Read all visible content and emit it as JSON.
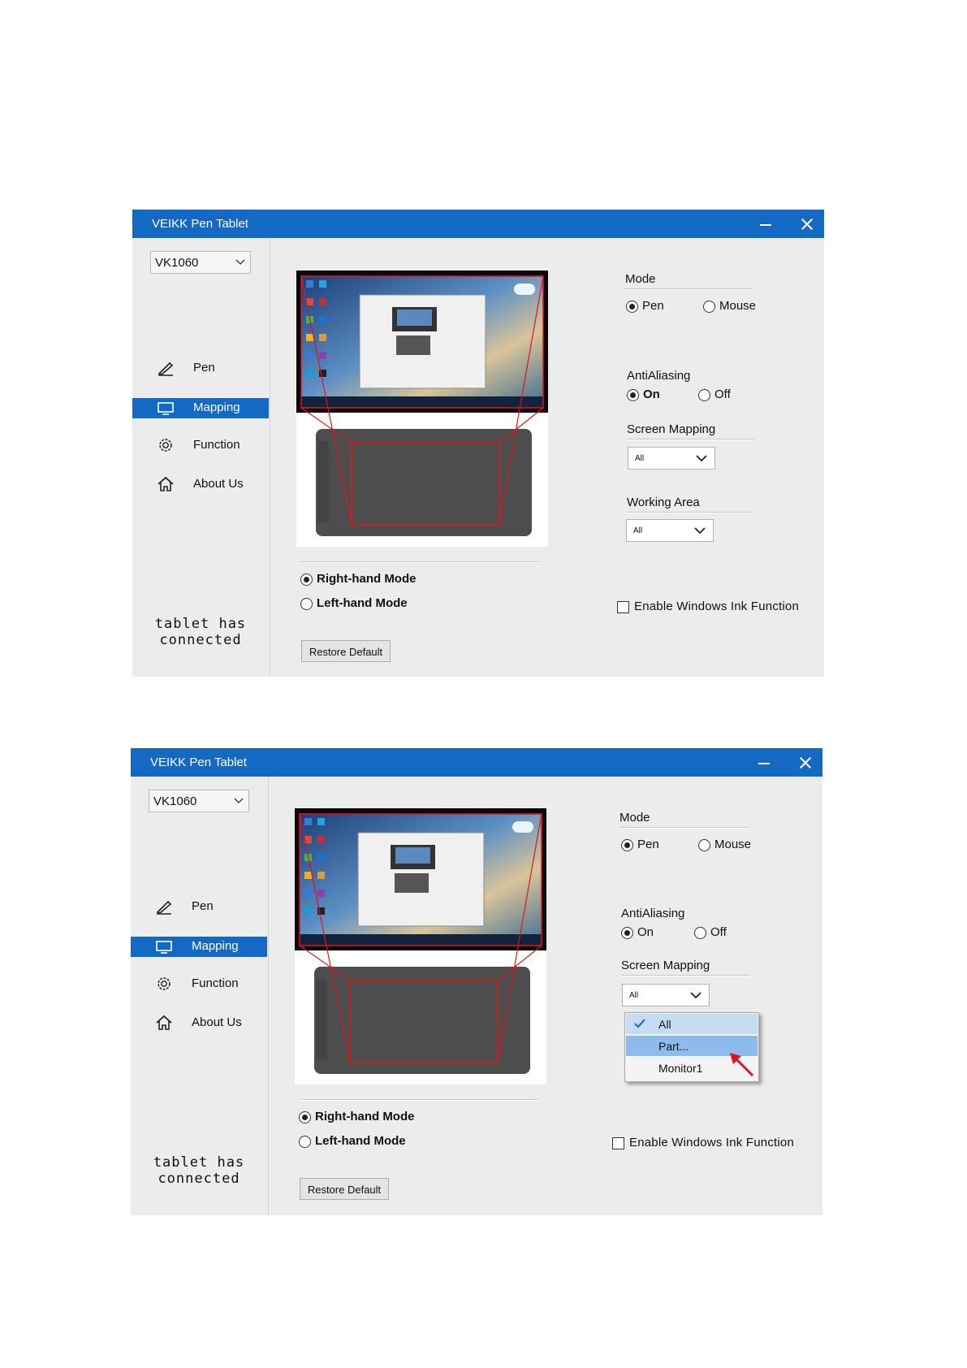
{
  "windows": [
    {
      "title": "VEIKK Pen Tablet",
      "device": "VK1060",
      "nav": [
        {
          "label": "Pen",
          "icon": "pen-icon"
        },
        {
          "label": "Mapping",
          "icon": "monitor-icon",
          "active": true
        },
        {
          "label": "Function",
          "icon": "gear-icon"
        },
        {
          "label": "About Us",
          "icon": "home-icon"
        }
      ],
      "status": [
        "tablet has",
        "connected"
      ],
      "hand_mode": {
        "right": "Right-hand Mode",
        "left": "Left-hand Mode",
        "selected": "right"
      },
      "restore_default": "Restore Default",
      "mode": {
        "label": "Mode",
        "pen": "Pen",
        "mouse": "Mouse",
        "selected": "pen"
      },
      "antialiasing": {
        "label": "AntiAliasing",
        "on": "On",
        "off": "Off",
        "selected": "on"
      },
      "screen_mapping": {
        "label": "Screen Mapping",
        "value": "All"
      },
      "working_area": {
        "label": "Working Area",
        "value": "All"
      },
      "windows_ink": {
        "label": "Enable Windows Ink Function",
        "checked": false
      }
    },
    {
      "title": "VEIKK Pen Tablet",
      "device": "VK1060",
      "nav": [
        {
          "label": "Pen",
          "icon": "pen-icon"
        },
        {
          "label": "Mapping",
          "icon": "monitor-icon",
          "active": true
        },
        {
          "label": "Function",
          "icon": "gear-icon"
        },
        {
          "label": "About Us",
          "icon": "home-icon"
        }
      ],
      "status": [
        "tablet has",
        "connected"
      ],
      "hand_mode": {
        "right": "Right-hand Mode",
        "left": "Left-hand Mode",
        "selected": "right"
      },
      "restore_default": "Restore Default",
      "mode": {
        "label": "Mode",
        "pen": "Pen",
        "mouse": "Mouse",
        "selected": "pen"
      },
      "antialiasing": {
        "label": "AntiAliasing",
        "on": "On",
        "off": "Off",
        "selected": "on"
      },
      "screen_mapping": {
        "label": "Screen Mapping",
        "value": "All",
        "options": [
          "All",
          "Part...",
          "Monitor1"
        ],
        "checked_option": "All",
        "hovered_option": "Part..."
      },
      "windows_ink": {
        "label": "Enable Windows Ink Function",
        "checked": false
      }
    }
  ],
  "colors": {
    "titlebar": "#1469c4",
    "window_bg": "#ececec",
    "mapping_lines": "#e0141e",
    "arrow": "#e0141e"
  }
}
